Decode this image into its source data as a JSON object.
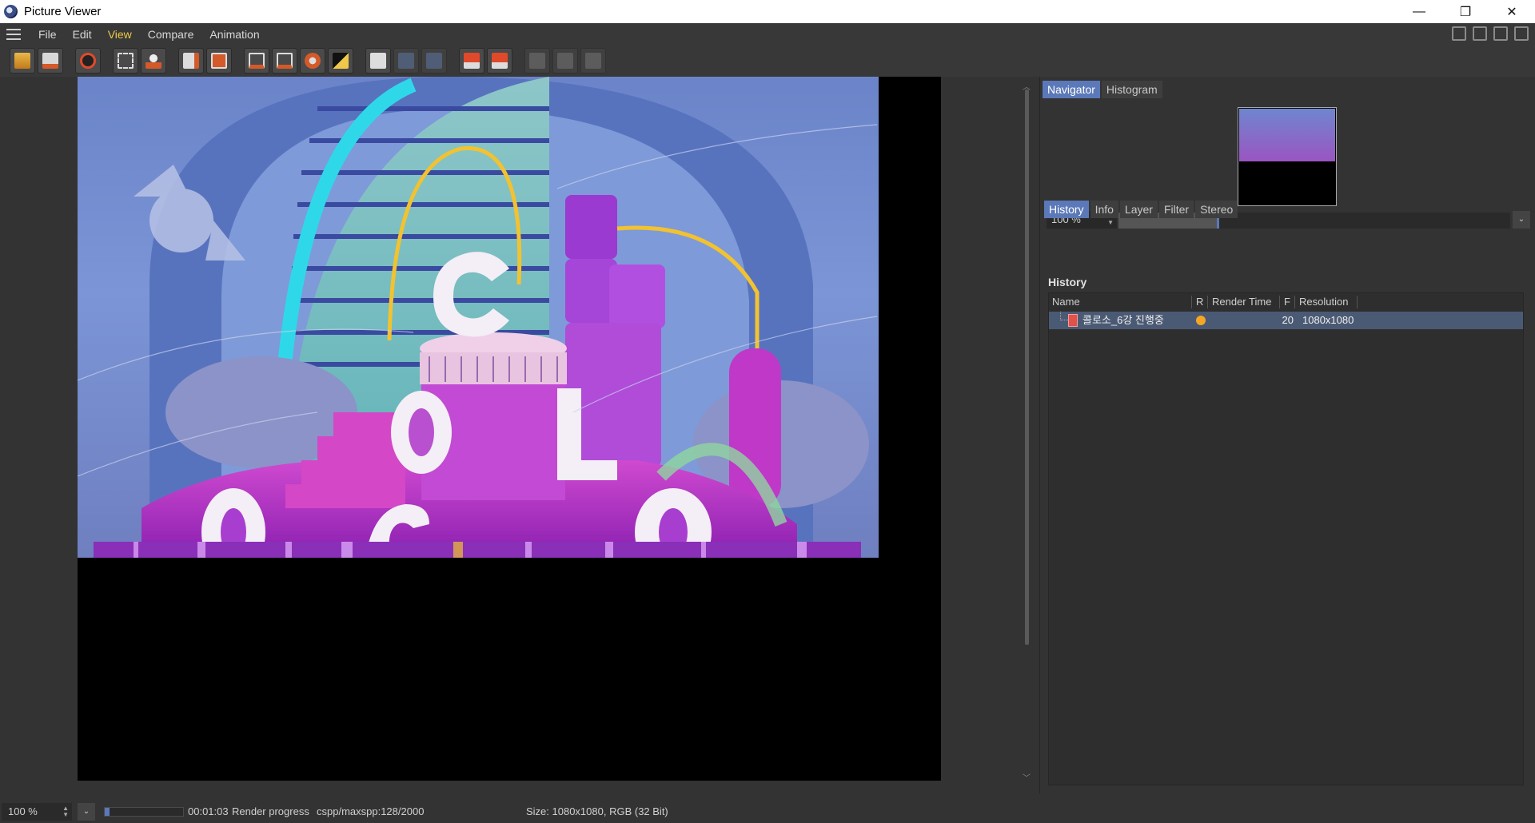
{
  "window": {
    "title": "Picture Viewer",
    "minimize": "—",
    "maximize": "❐",
    "close": "✕"
  },
  "menu": [
    "File",
    "Edit",
    "View",
    "Compare",
    "Animation"
  ],
  "right_panel": {
    "top_tabs": [
      "Navigator",
      "Histogram"
    ],
    "zoom_value": "100 %",
    "zoom_level": 0.25,
    "lower_tabs": [
      "History",
      "Info",
      "Layer",
      "Filter",
      "Stereo"
    ],
    "history_title": "History",
    "columns": [
      "Name",
      "R",
      "Render Time",
      "F",
      "Resolution"
    ],
    "rows": [
      {
        "name": "콜로소_6강 진행중",
        "status_color": "#f5a623",
        "render_time": "",
        "frame": "20",
        "resolution": "1080x1080"
      }
    ]
  },
  "status": {
    "zoom_value": "100 %",
    "progress": 0.064,
    "time": "00:01:03",
    "label": "Render progress",
    "detail": "cspp/maxspp:128/2000",
    "size_info": "Size: 1080x1080, RGB (32 Bit)"
  }
}
